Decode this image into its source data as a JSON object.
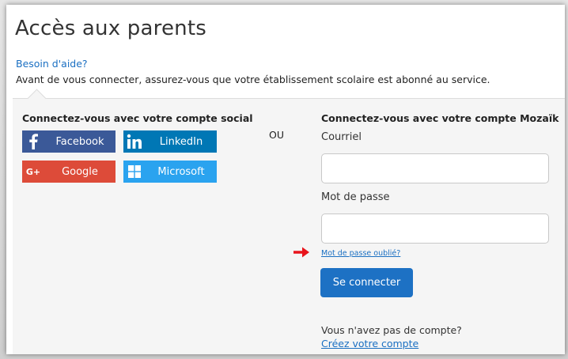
{
  "page": {
    "title": "Accès aux parents",
    "help_link": "Besoin d'aide?",
    "notice": "Avant de vous connecter, assurez-vous que votre établissement scolaire est abonné au service."
  },
  "social": {
    "heading": "Connectez-vous avec votre compte social",
    "buttons": [
      {
        "label": "Facebook",
        "icon": "facebook-icon",
        "color": "#3b5998"
      },
      {
        "label": "LinkedIn",
        "icon": "linkedin-icon",
        "color": "#0077b5"
      },
      {
        "label": "Google",
        "icon": "google-plus-icon",
        "color": "#dd4b39"
      },
      {
        "label": "Microsoft",
        "icon": "microsoft-icon",
        "color": "#2aa3ef"
      }
    ]
  },
  "separator": "OU",
  "mozaik": {
    "heading": "Connectez-vous avec votre compte Mozaïk",
    "email_label": "Courriel",
    "email_value": "",
    "password_label": "Mot de passe",
    "password_value": "",
    "forgot_link": "Mot de passe oublié?",
    "connect_button": "Se connecter",
    "no_account": "Vous n'avez pas de compte?",
    "create_link": "Créez votre compte"
  },
  "colors": {
    "accent": "#1d71c4",
    "link": "#1a6fc2",
    "arrow": "#e8141c"
  }
}
